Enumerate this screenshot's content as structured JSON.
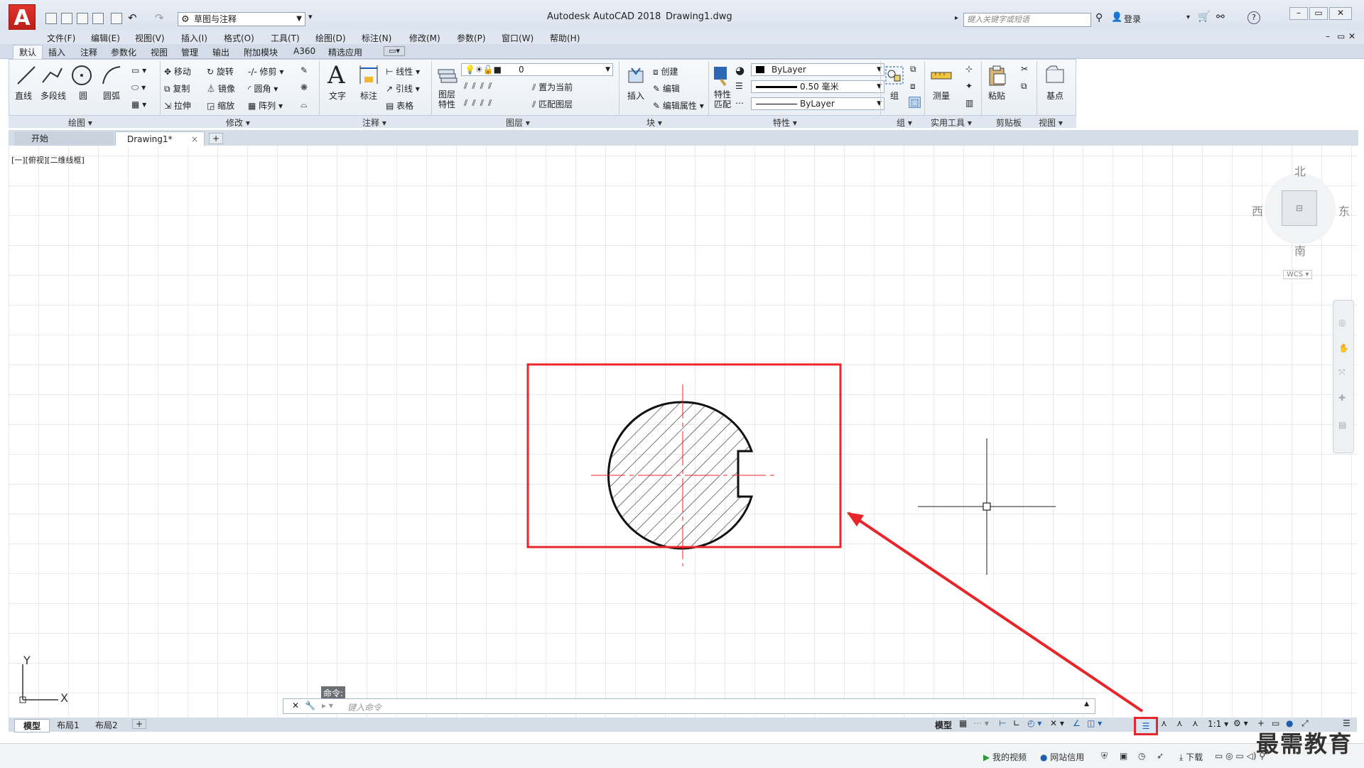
{
  "titlebar": {
    "app_letter": "A",
    "workspace": "草图与注释",
    "app_title": "Autodesk AutoCAD 2018",
    "document": "Drawing1.dwg",
    "search_placeholder": "键入关键字或短语",
    "login_label": "登录",
    "help_label": "?"
  },
  "menu": [
    "文件(F)",
    "编辑(E)",
    "视图(V)",
    "插入(I)",
    "格式(O)",
    "工具(T)",
    "绘图(D)",
    "标注(N)",
    "修改(M)",
    "参数(P)",
    "窗口(W)",
    "帮助(H)"
  ],
  "ribbon_tabs": [
    "默认",
    "插入",
    "注释",
    "参数化",
    "视图",
    "管理",
    "输出",
    "附加模块",
    "A360",
    "精选应用"
  ],
  "ribbon": {
    "draw": {
      "title": "绘图",
      "line": "直线",
      "polyline": "多段线",
      "circle": "圆",
      "arc": "圆弧"
    },
    "modify": {
      "title": "修改",
      "move": "移动",
      "rotate": "旋转",
      "trim": "修剪",
      "copy": "复制",
      "mirror": "镜像",
      "fillet": "圆角",
      "stretch": "拉伸",
      "scale": "缩放",
      "array": "阵列"
    },
    "annotation": {
      "title": "注释",
      "text": "文字",
      "dimension": "标注",
      "linear": "线性",
      "leader": "引线",
      "table": "表格"
    },
    "layers": {
      "title": "图层",
      "properties": "图层特性",
      "current_layer": "0",
      "set_current": "置为当前",
      "match_layer": "匹配图层"
    },
    "block": {
      "title": "块",
      "insert": "插入",
      "create": "创建",
      "edit": "编辑",
      "edit_attr": "编辑属性"
    },
    "properties": {
      "title": "特性",
      "match": "特性匹配",
      "color": "ByLayer",
      "lineweight": "0.50 毫米",
      "linetype": "ByLayer"
    },
    "groups": {
      "title": "组",
      "group": "组"
    },
    "utilities": {
      "title": "实用工具",
      "measure": "测量"
    },
    "clipboard": {
      "title": "剪贴板",
      "paste": "粘贴"
    },
    "view": {
      "title": "视图",
      "base": "基点"
    }
  },
  "doc_tabs": {
    "start": "开始",
    "drawing": "Drawing1*",
    "close": "×",
    "add": "+"
  },
  "viewport_label": "[一][俯视][二维线框]",
  "viewcube": {
    "north": "北",
    "south": "南",
    "east": "东",
    "west": "西",
    "wcs": "WCS"
  },
  "ucs": {
    "x": "X",
    "y": "Y"
  },
  "command": {
    "history": "命令:",
    "placeholder": "键入命令"
  },
  "layout_tabs": [
    "模型",
    "布局1",
    "布局2"
  ],
  "status": {
    "model": "模型",
    "scale": "1:1"
  },
  "taskbar": {
    "video": "我的视频",
    "credit": "网站信用",
    "download": "下载"
  },
  "watermark": "最需教育",
  "colors": {
    "annotation_red": "#e8262a",
    "crosshair": "#222222",
    "grid": "#c9ced4",
    "centerline": "#e8262a"
  }
}
